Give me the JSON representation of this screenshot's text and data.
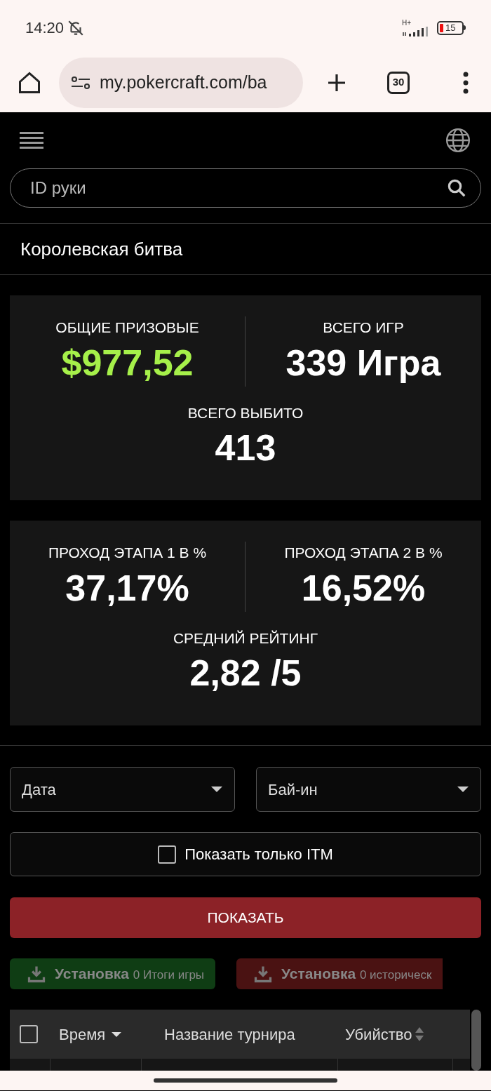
{
  "status_bar": {
    "time": "14:20",
    "network": "H+",
    "battery": "15"
  },
  "browser": {
    "url": "my.pokercraft.com/ba",
    "tab_count": "30"
  },
  "search": {
    "placeholder": "ID руки"
  },
  "page_title": "Королевская битва",
  "stat_cards": [
    {
      "stats": [
        {
          "label": "ОБЩИЕ ПРИЗОВЫЕ",
          "value": "$977,52",
          "highlight": true
        },
        {
          "label": "ВСЕГО ИГР",
          "value": "339 Игра",
          "highlight": false
        },
        {
          "label": "ВСЕГО ВЫБИТО",
          "value": "413",
          "highlight": false
        }
      ]
    },
    {
      "stats": [
        {
          "label": "ПРОХОД ЭТАПА 1 В %",
          "value": "37,17%",
          "highlight": false
        },
        {
          "label": "ПРОХОД ЭТАПА 2 В %",
          "value": "16,52%",
          "highlight": false
        },
        {
          "label": "СРЕДНИЙ РЕЙТИНГ",
          "value": "2,82 /5",
          "highlight": false
        }
      ]
    }
  ],
  "filters": [
    {
      "placeholder": "Дата"
    },
    {
      "placeholder": "Бай-ин"
    }
  ],
  "itm_checkbox": {
    "label": "Показать только ITM",
    "checked": false
  },
  "show_button": "ПОКАЗАТЬ",
  "download_buttons": [
    {
      "label": "Установка",
      "count": "0 Итоги игры",
      "color": "#0f3d14"
    },
    {
      "label": "Установка",
      "count": "0 историческ",
      "color": "#4a1212"
    }
  ],
  "table": {
    "select_all_checked": false,
    "columns": [
      {
        "label": "Время",
        "kind": "sort-desc"
      },
      {
        "label": "Название турнира",
        "kind": "plain"
      },
      {
        "label": "Убийство",
        "kind": "sortable"
      }
    ]
  }
}
